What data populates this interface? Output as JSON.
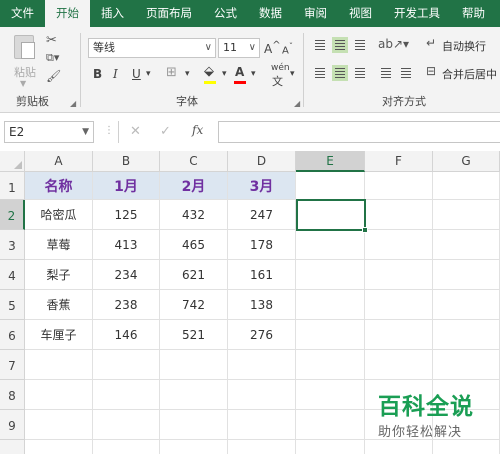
{
  "ribbon_tabs": [
    "文件",
    "开始",
    "插入",
    "页面布局",
    "公式",
    "数据",
    "审阅",
    "视图",
    "开发工具",
    "帮助"
  ],
  "active_tab": "开始",
  "clipboard": {
    "paste_label": "粘贴",
    "group_label": "剪贴板"
  },
  "font": {
    "family": "等线",
    "size": "11",
    "grow": "A",
    "shrink": "A",
    "bold": "B",
    "italic": "I",
    "underline": "U",
    "font_color_letter": "A",
    "phonetic": "wén",
    "group_label": "字体",
    "fill_color": "#ffff00",
    "font_color": "#ff0000"
  },
  "alignment": {
    "wrap_text": "自动换行",
    "merge_center": "合并后居中",
    "group_label": "对齐方式"
  },
  "formula_bar": {
    "name_box": "E2",
    "fx": "fx",
    "value": ""
  },
  "columns": [
    "A",
    "B",
    "C",
    "D",
    "E",
    "F",
    "G"
  ],
  "rows": [
    "1",
    "2",
    "3",
    "4",
    "5",
    "6",
    "7",
    "8",
    "9"
  ],
  "selected_cell": "E2",
  "table": {
    "headers": [
      "名称",
      "1月",
      "2月",
      "3月"
    ],
    "rows": [
      [
        "哈密瓜",
        "125",
        "432",
        "247"
      ],
      [
        "草莓",
        "413",
        "465",
        "178"
      ],
      [
        "梨子",
        "234",
        "621",
        "161"
      ],
      [
        "香蕉",
        "238",
        "742",
        "138"
      ],
      [
        "车厘子",
        "146",
        "521",
        "276"
      ]
    ]
  },
  "watermark": {
    "main": "百科全说",
    "sub": "助你轻松解决"
  },
  "colors": {
    "accent": "#217346",
    "header_fill": "#dce6f1",
    "header_text": "#7030a0",
    "watermark": "#1a9e54"
  }
}
